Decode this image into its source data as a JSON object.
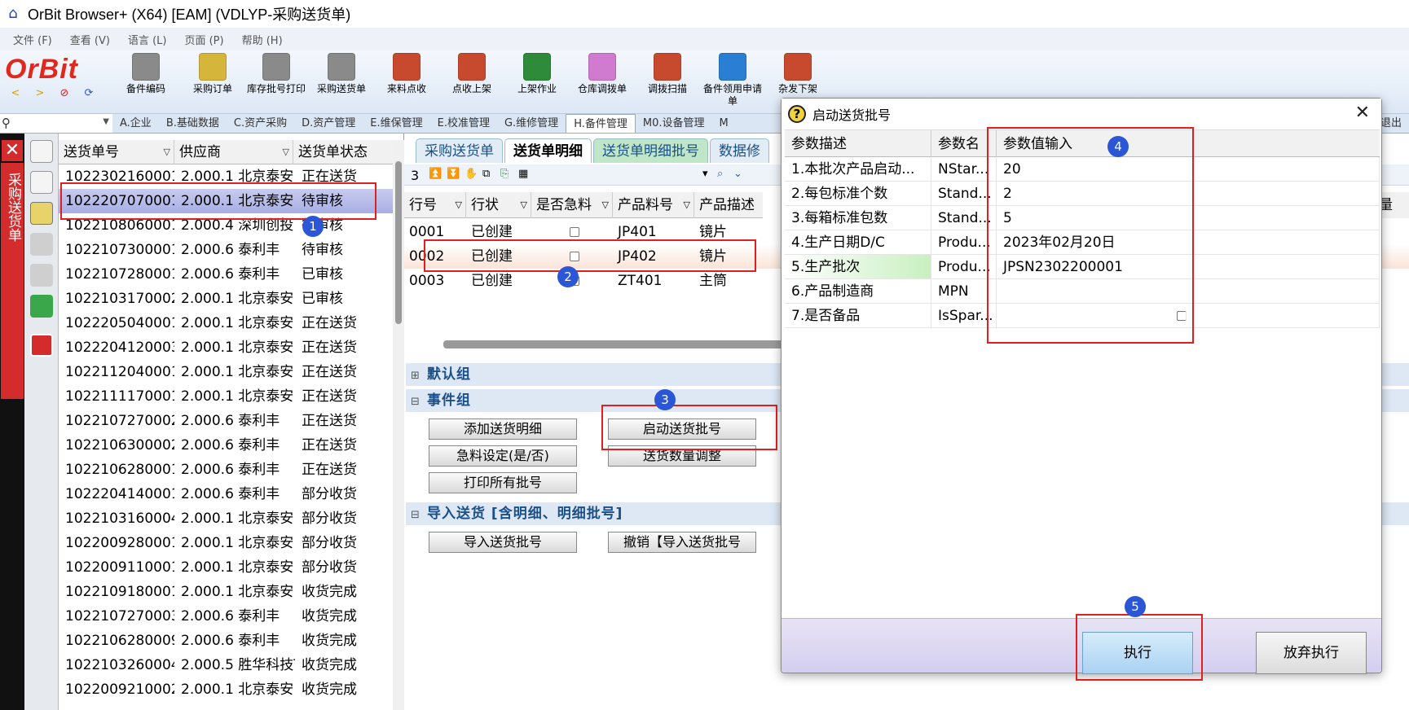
{
  "window": {
    "title": "OrBit Browser+ (X64) [EAM] (VDLYP-采购送货单)"
  },
  "menu": [
    "文件 (F)",
    "查看 (V)",
    "语言 (L)",
    "页面 (P)",
    "帮助 (H)"
  ],
  "brand": {
    "logo": "OrBit",
    "accent": "#e0281c"
  },
  "toolbar": [
    {
      "label": "备件编码",
      "color": "#6a6a6a"
    },
    {
      "label": "采购订单",
      "color": "#c8a72a"
    },
    {
      "label": "库存批号打印",
      "color": "#6a6a6a"
    },
    {
      "label": "采购送货单",
      "color": "#6a6a6a"
    },
    {
      "label": "来料点收",
      "color": "#c0392b"
    },
    {
      "label": "点收上架",
      "color": "#c0392b"
    },
    {
      "label": "上架作业",
      "color": "#2e8b3a"
    },
    {
      "label": "仓库调拨单",
      "color": "#d07ad0"
    },
    {
      "label": "调拨扫描",
      "color": "#c0392b"
    },
    {
      "label": "备件领用申请单",
      "color": "#2a7fd4"
    },
    {
      "label": "杂发下架",
      "color": "#c0392b"
    }
  ],
  "module_tabs": [
    "A.企业",
    "B.基础数据",
    "C.资产采购",
    "D.资产管理",
    "E.维保管理",
    "E.校准管理",
    "G.维修管理",
    "H.备件管理",
    "M0.设备管理",
    "M",
    "退出"
  ],
  "sidebar_label": "采购送货单",
  "list": {
    "headers": [
      "送货单号",
      "供应商",
      "送货单状态"
    ],
    "rows": [
      [
        "1022302160001",
        "2.000.1 北京泰安",
        "正在送货"
      ],
      [
        "1022207070001",
        "2.000.1 北京泰安",
        "待审核"
      ],
      [
        "1022108060001",
        "2.000.4 深圳创投",
        "待审核"
      ],
      [
        "1022107300001",
        "2.000.6 泰利丰",
        "待审核"
      ],
      [
        "1022107280001",
        "2.000.6 泰利丰",
        "已审核"
      ],
      [
        "1022103170002",
        "2.000.1 北京泰安",
        "已审核"
      ],
      [
        "1022205040001",
        "2.000.1 北京泰安",
        "正在送货"
      ],
      [
        "1022204120003",
        "2.000.1 北京泰安",
        "正在送货"
      ],
      [
        "1022112040001",
        "2.000.1 北京泰安",
        "正在送货"
      ],
      [
        "1022111170001",
        "2.000.1 北京泰安",
        "正在送货"
      ],
      [
        "1022107270002",
        "2.000.6 泰利丰",
        "正在送货"
      ],
      [
        "1022106300002",
        "2.000.6 泰利丰",
        "正在送货"
      ],
      [
        "1022106280001",
        "2.000.6 泰利丰",
        "正在送货"
      ],
      [
        "1022204140001",
        "2.000.6 泰利丰",
        "部分收货"
      ],
      [
        "1022103160004",
        "2.000.1 北京泰安",
        "部分收货"
      ],
      [
        "1022009280001",
        "2.000.1 北京泰安",
        "部分收货"
      ],
      [
        "1022009110001",
        "2.000.1 北京泰安",
        "部分收货"
      ],
      [
        "1022109180001",
        "2.000.1 北京泰安",
        "收货完成"
      ],
      [
        "1022107270003",
        "2.000.6 泰利丰",
        "收货完成"
      ],
      [
        "1022106280009",
        "2.000.6 泰利丰",
        "收货完成"
      ],
      [
        "1022103260004",
        "2.000.5 胜华科技T",
        "收货完成"
      ],
      [
        "1022009210002",
        "2.000.1 北京泰安",
        "收货完成"
      ]
    ]
  },
  "sub_tabs": [
    "采购送货单",
    "送货单明细",
    "送货单明细批号",
    "数据修"
  ],
  "detail": {
    "count": "3",
    "headers": [
      "行号",
      "行状",
      "是否急料",
      "产品料号",
      "产品描述"
    ],
    "rows": [
      [
        "0001",
        "已创建",
        "JP401",
        "镜片"
      ],
      [
        "0002",
        "已创建",
        "JP402",
        "镜片"
      ],
      [
        "0003",
        "已创建",
        "ZT401",
        "主筒"
      ]
    ],
    "extra_header": "量"
  },
  "groups": {
    "default": "默认组",
    "event": "事件组",
    "import": "导入送货 [含明细、明细批号]"
  },
  "event_buttons": {
    "add_detail": "添加送货明细",
    "start_batch": "启动送货批号",
    "urgent": "急料设定(是/否)",
    "qty_adjust": "送货数量调整",
    "print_all": "打印所有批号"
  },
  "import_buttons": {
    "import_batch": "导入送货批号",
    "undo_import": "撤销【导入送货批号"
  },
  "dialog": {
    "title": "启动送货批号",
    "headers": [
      "参数描述",
      "参数名",
      "参数值输入"
    ],
    "rows": [
      [
        "1.本批次产品启动...",
        "NStar...",
        "20"
      ],
      [
        "2.每包标准个数",
        "Stand...",
        "2"
      ],
      [
        "3.每箱标准包数",
        "Stand...",
        "5"
      ],
      [
        "4.生产日期D/C",
        "Produ...",
        "2023年02月20日"
      ],
      [
        "5.生产批次",
        "Produ...",
        "JPSN2302200001"
      ],
      [
        "6.产品制造商",
        "MPN",
        ""
      ],
      [
        "7.是否备品",
        "IsSpar...",
        ""
      ]
    ],
    "execute": "执行",
    "abort": "放弃执行"
  },
  "badges": [
    "1",
    "2",
    "3",
    "4",
    "5"
  ]
}
